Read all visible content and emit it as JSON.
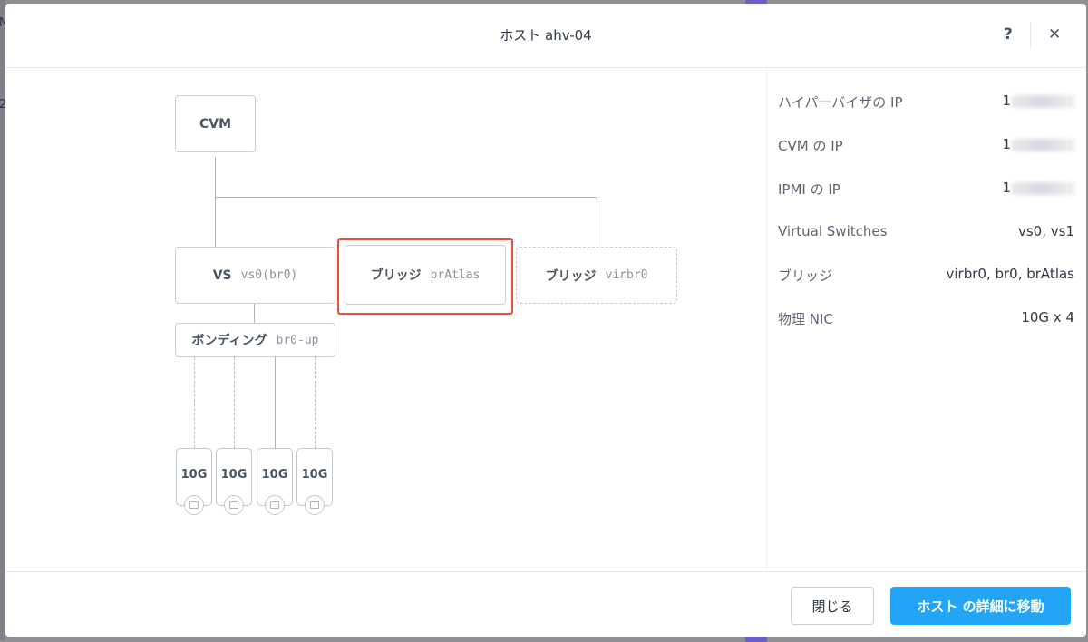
{
  "window": {
    "title": "ホスト ahv-04",
    "help_label": "?",
    "close_label": "✕"
  },
  "background": {
    "frag1": "N",
    "frag2": "2"
  },
  "diagram": {
    "cvm": {
      "label": "CVM"
    },
    "vs": {
      "label": "VS",
      "sub": "vs0(br0)"
    },
    "bridge1": {
      "label": "ブリッジ",
      "sub": "brAtlas"
    },
    "bridge2": {
      "label": "ブリッジ",
      "sub": "virbr0"
    },
    "bond": {
      "label": "ボンディング",
      "sub": "br0-up"
    },
    "nics": [
      "10G",
      "10G",
      "10G",
      "10G"
    ]
  },
  "details": [
    {
      "key": "ハイパーバイザの IP",
      "value": "1"
    },
    {
      "key": "CVM の IP",
      "value": "1"
    },
    {
      "key": "IPMI の IP",
      "value": "1"
    },
    {
      "key": "Virtual Switches",
      "value": "vs0, vs1"
    },
    {
      "key": "ブリッジ",
      "value": "virbr0, br0, brAtlas"
    },
    {
      "key": "物理 NIC",
      "value": "10G x 4"
    }
  ],
  "footer": {
    "close_label": "閉じる",
    "go_label": "ホスト の詳細に移動"
  },
  "colors": {
    "accent": "#22a5f7",
    "highlight": "#e8503a"
  }
}
